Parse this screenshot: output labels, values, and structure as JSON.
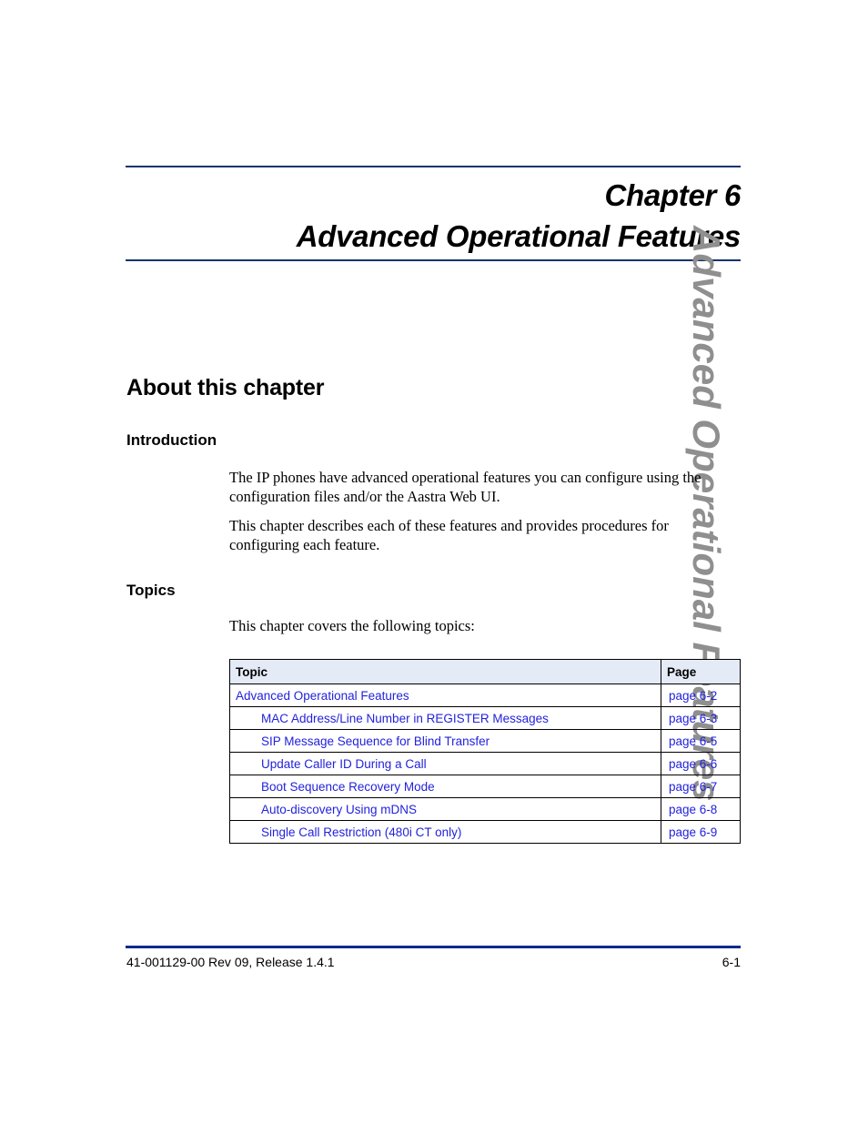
{
  "chapter": {
    "number_line": "Chapter 6",
    "title_line": "Advanced Operational Features"
  },
  "side_tab": {
    "label": "Advanced Operational Features",
    "color": "#8f8f8f"
  },
  "sections": {
    "about_heading": "About this chapter",
    "introduction_heading": "Introduction",
    "introduction_paragraph_1": "The IP phones have advanced operational features you can configure using the configuration files and/or the Aastra Web UI.",
    "introduction_paragraph_2": "This chapter describes each of these features and provides procedures for configuring each feature.",
    "topics_heading": "Topics",
    "topics_lead": "This chapter covers the following topics:"
  },
  "topics_table": {
    "headers": {
      "topic": "Topic",
      "page": "Page"
    },
    "header_fill": "#e4eaf6",
    "link_color": "#2222dd",
    "rows": [
      {
        "topic": "Advanced Operational Features",
        "page": "page 6-2",
        "indent": false
      },
      {
        "topic": "MAC Address/Line Number in REGISTER Messages",
        "page": "page 6-3",
        "indent": true
      },
      {
        "topic": "SIP Message Sequence for Blind Transfer",
        "page": "page 6-5",
        "indent": true
      },
      {
        "topic": "Update Caller ID During a Call",
        "page": "page 6-6",
        "indent": true
      },
      {
        "topic": "Boot Sequence Recovery Mode",
        "page": "page 6-7",
        "indent": true
      },
      {
        "topic": "Auto-discovery Using mDNS",
        "page": "page 6-8",
        "indent": true
      },
      {
        "topic": "Single Call Restriction (480i CT only)",
        "page": "page 6-9",
        "indent": true
      }
    ]
  },
  "footer": {
    "document_id": "41-001129-00 Rev 09, Release 1.4.1",
    "page_number": "6-1",
    "rule_color": "#0a2a8c"
  },
  "rules": {
    "title_rule_color": "#10336e"
  }
}
